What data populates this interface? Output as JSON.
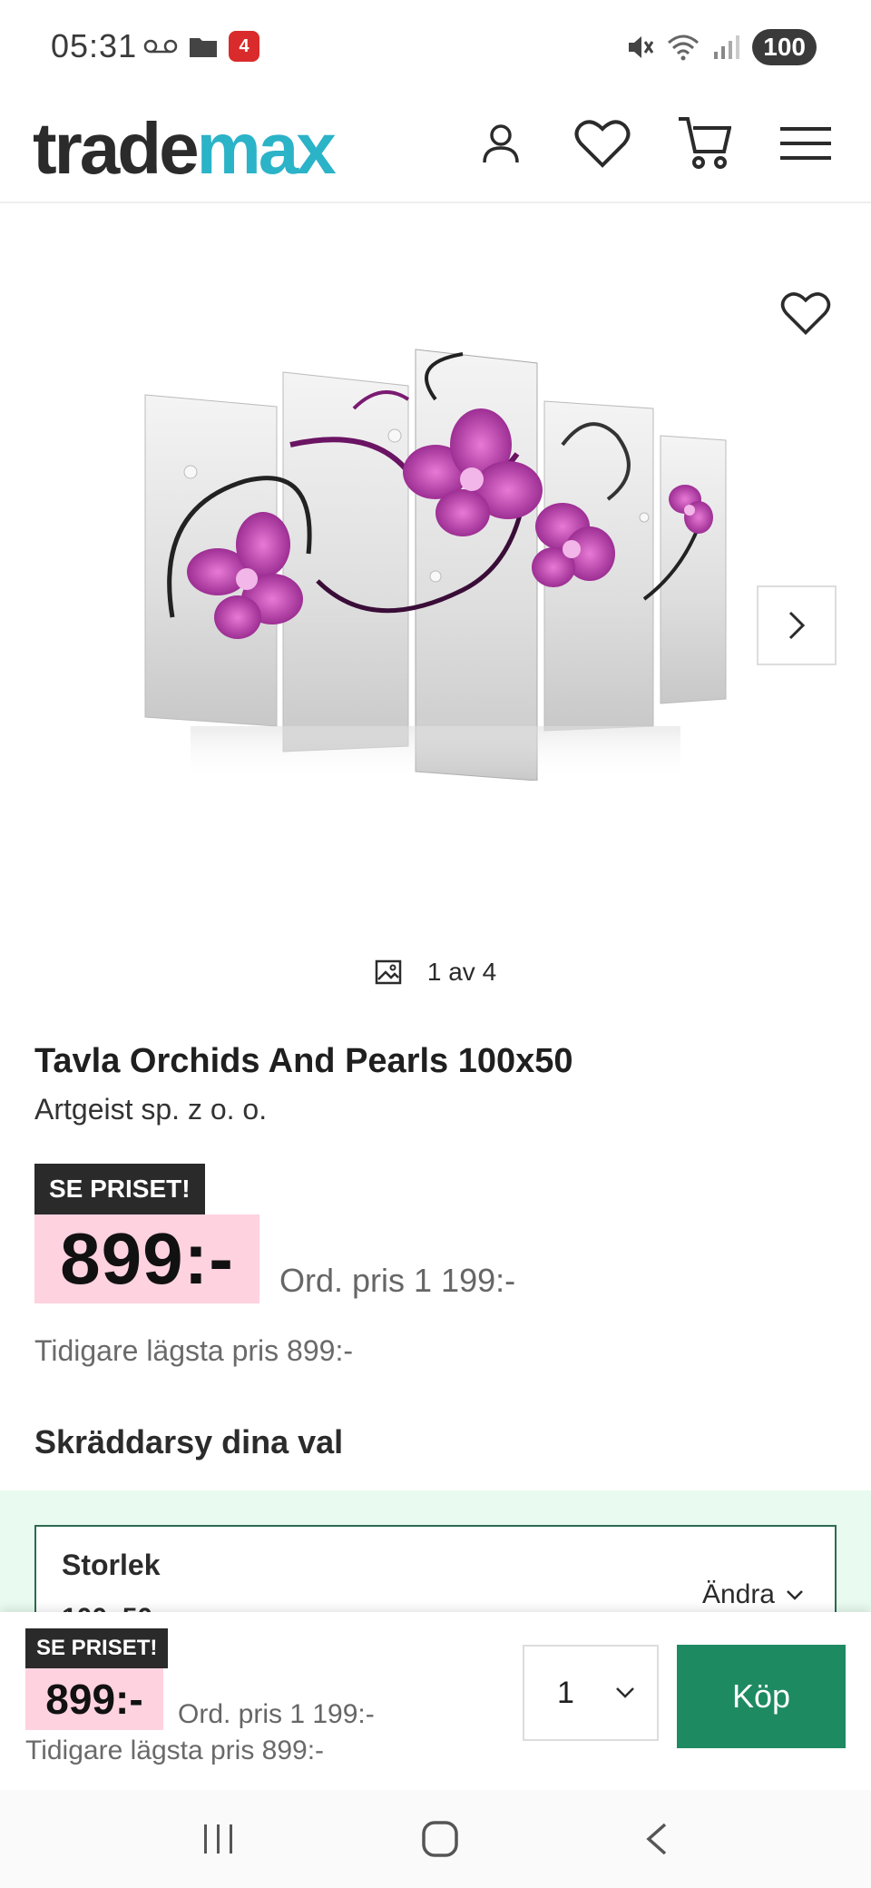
{
  "status_bar": {
    "time": "05:31",
    "notification_badge": "4",
    "battery": "100",
    "icons": [
      "voicemail-icon",
      "folder-icon",
      "mute-icon",
      "wifi-icon",
      "signal-icon"
    ]
  },
  "header": {
    "logo_part1": "trade",
    "logo_part2": "max",
    "icons": [
      "account-icon",
      "wishlist-heart-icon",
      "cart-icon",
      "menu-icon"
    ],
    "brand_colors": {
      "dark": "#2b2b2b",
      "teal": "#2bb3c8"
    }
  },
  "gallery": {
    "counter": "1 av 4",
    "image_alt": "Orchids and pearls canvas art"
  },
  "product": {
    "title": "Tavla Orchids And Pearls 100x50",
    "brand": "Artgeist sp. z o. o.",
    "badge": "SE PRISET!",
    "price": "899:-",
    "ordinary_price": "Ord. pris 1 199:-",
    "lowest_price": "Tidigare lägsta pris 899:-"
  },
  "customize": {
    "section_title": "Skräddarsy dina val",
    "option_label": "Storlek",
    "option_value": "100x50",
    "change_label": "Ändra"
  },
  "buy_bar": {
    "badge": "SE PRISET!",
    "price": "899:-",
    "ordinary_price": "Ord. pris 1 199:-",
    "lowest_price": "Tidigare lägsta pris 899:-",
    "quantity": "1",
    "buy_label": "Köp",
    "buy_color": "#1e8a62"
  },
  "colors": {
    "price_highlight": "#ffd2e0",
    "options_band": "#e9fbf0"
  }
}
